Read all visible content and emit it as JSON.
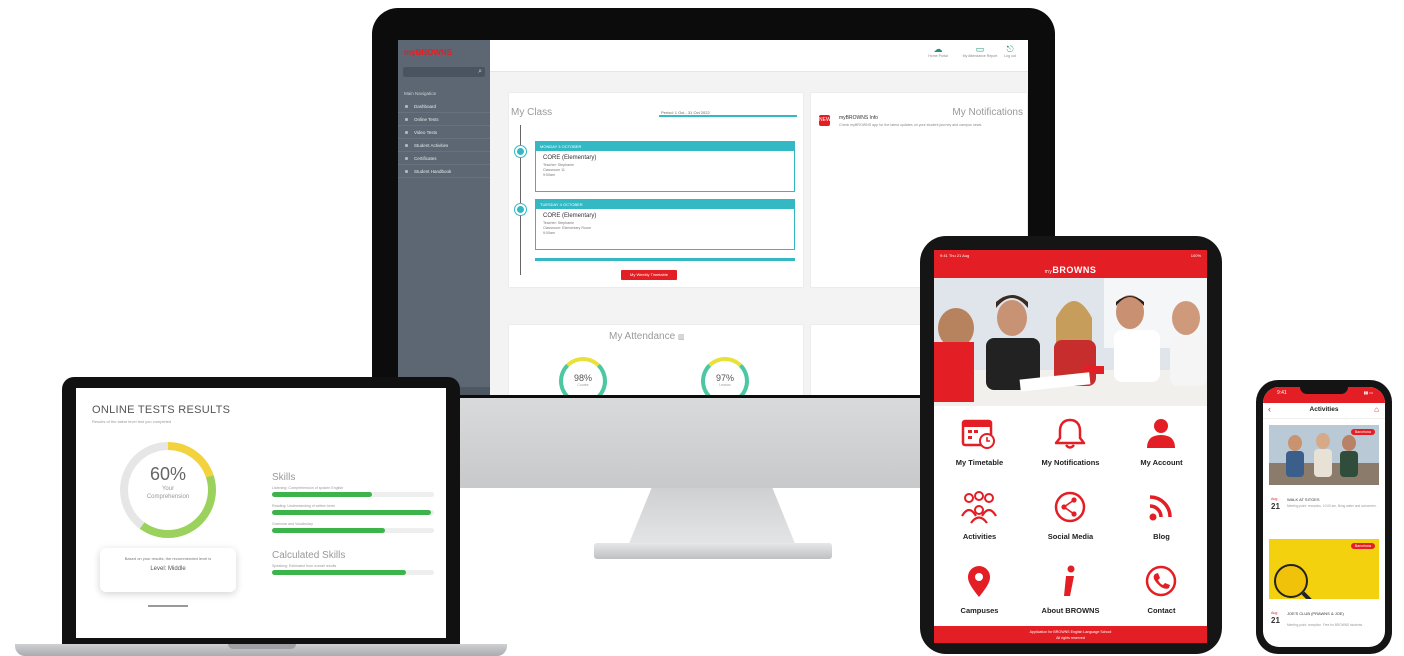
{
  "monitor": {
    "logo": "myBROWNS",
    "sidebar": {
      "section": "Main Navigation",
      "items": [
        {
          "label": "Dashboard"
        },
        {
          "label": "Online Tests"
        },
        {
          "label": "Video Tests"
        },
        {
          "label": "Student Activities"
        },
        {
          "label": "Certificates"
        },
        {
          "label": "Student Handbook"
        }
      ]
    },
    "topbar": [
      {
        "label": "Home Portal"
      },
      {
        "label": "My Attendance Report"
      },
      {
        "label": "Log out"
      }
    ],
    "my_class": {
      "title": "My Class",
      "term_select": "Period: 1 Oct - 31 Oct 2022",
      "classes": [
        {
          "date": "MONDAY 3 OCTOBER",
          "name": "CORE (Elementary)",
          "teacher": "Teacher: Stephanie",
          "room": "Classroom 11",
          "time": "9:00am"
        },
        {
          "date": "TUESDAY 4 OCTOBER",
          "name": "CORE (Elementary)",
          "teacher": "Teacher: Stephanie",
          "room": "Classroom: Elementary Room",
          "time": "9:00am"
        }
      ],
      "button": "My Weekly Timetable"
    },
    "notifications": {
      "title": "My Notifications",
      "icon_text": "NEW",
      "item_title": "myBROWNS Info",
      "item_text": "Check myBROWNS app for the latest updates on your student journey and campus news."
    },
    "attendance": {
      "title": "My Attendance",
      "gauges": [
        {
          "value": "98%",
          "label": "Course"
        },
        {
          "value": "97%",
          "label": "Lesson"
        }
      ]
    }
  },
  "laptop": {
    "title": "ONLINE TESTS RESULTS",
    "subtitle": "Results of the latest level test you completed",
    "donut": {
      "value": "60%",
      "label": "Your Comprehension",
      "percent": 60
    },
    "result": {
      "text": "Based on your results, the recommended level is",
      "level": "Level: Middle"
    },
    "skills_title": "Skills",
    "skills": [
      {
        "label": "Listening: Comprehension of spoken English",
        "percent": 62
      },
      {
        "label": "Reading: Understanding of written texts",
        "percent": 98
      },
      {
        "label": "Grammar and Vocabulary",
        "percent": 70
      }
    ],
    "calculated_title": "Calculated Skills",
    "calculated": [
      {
        "label": "Speaking: Estimated from overall results",
        "percent": 83
      }
    ]
  },
  "tablet": {
    "status_left": "9:41  Thu 21 Aug",
    "status_right": "100%",
    "brand_prefix": "my",
    "brand": "BROWNS",
    "tiles": [
      {
        "label": "My Timetable",
        "icon": "calendar-icon"
      },
      {
        "label": "My Notifications",
        "icon": "bell-icon"
      },
      {
        "label": "My Account",
        "icon": "user-icon"
      },
      {
        "label": "Activities",
        "icon": "group-icon"
      },
      {
        "label": "Social Media",
        "icon": "share-icon"
      },
      {
        "label": "Blog",
        "icon": "rss-icon"
      },
      {
        "label": "Campuses",
        "icon": "map-pin-icon"
      },
      {
        "label": "About BROWNS",
        "icon": "info-icon"
      },
      {
        "label": "Contact",
        "icon": "phone-icon"
      }
    ],
    "footer_line1": "Application for BROWNS English Language School",
    "footer_line2": "All rights reserved",
    "accent": "#e31e24"
  },
  "phone": {
    "time": "9:41",
    "title": "Activities",
    "events": [
      {
        "badge": "Barcelona",
        "month": "Aug",
        "day": "21",
        "title": "WALK AT SITGES",
        "meta": "Meeting point: reception, 10:00 am. Bring water and sunscreen."
      },
      {
        "badge": "Barcelona",
        "month": "Aug",
        "day": "21",
        "title": "JOE'S CLUB (PRAWNS & JOE)",
        "meta": "Meeting point: reception. Free for BROWNS students."
      }
    ]
  }
}
